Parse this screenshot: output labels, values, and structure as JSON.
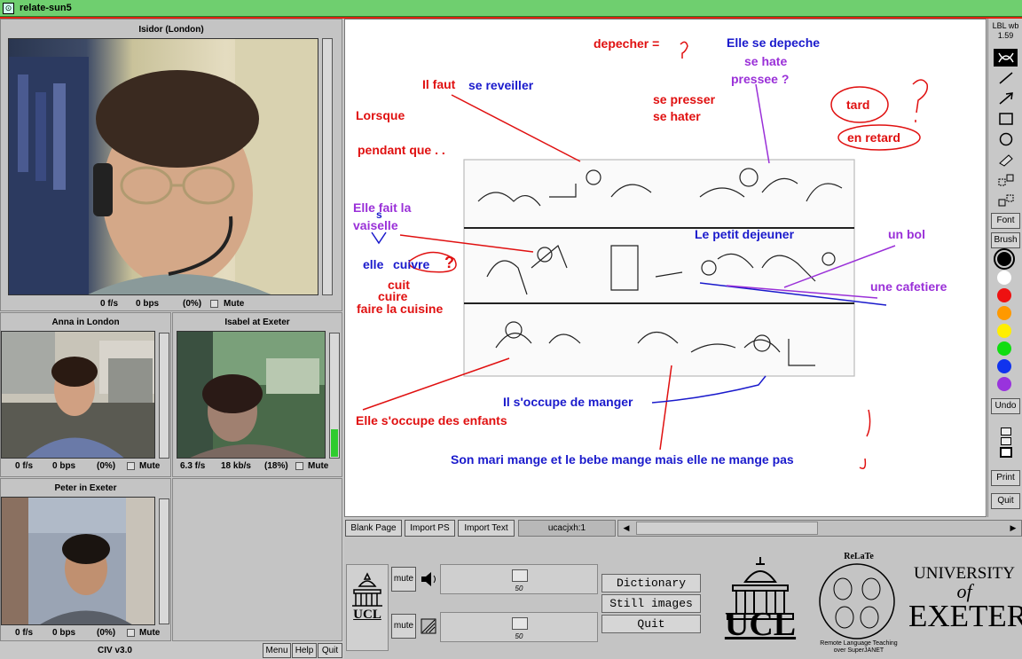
{
  "window": {
    "title": "relate-sun5",
    "menu_glyph": "⊙"
  },
  "videos": {
    "main": {
      "title": "Isidor (London)",
      "fps": "0 f/s",
      "bps": "0 bps",
      "pct": "(0%)",
      "mute": "Mute",
      "level": 0.0
    },
    "anna": {
      "title": "Anna in London",
      "fps": "0 f/s",
      "bps": "0 bps",
      "pct": "(0%)",
      "mute": "Mute",
      "level": 0.0
    },
    "isabel": {
      "title": "Isabel at Exeter",
      "fps": "6.3 f/s",
      "bps": "18 kb/s",
      "pct": "(18%)",
      "mute": "Mute",
      "level": 0.22
    },
    "peter": {
      "title": "Peter in Exeter",
      "fps": "0 f/s",
      "bps": "0 bps",
      "pct": "(0%)",
      "mute": "Mute",
      "level": 0.0
    }
  },
  "status_bar": {
    "version": "CIV v3.0",
    "menu": "Menu",
    "help": "Help",
    "quit": "Quit"
  },
  "whiteboard": {
    "annotations": {
      "depecher": "depecher = ",
      "elle_se_depeche": "Elle se depeche",
      "se_hate": "se hate",
      "pressee": "pressee ?",
      "il_faut": "Il faut",
      "se_reveiller": "se reveiller",
      "se_presser": "se presser",
      "se_hater": "se hater",
      "tard": "tard",
      "en_retard": "en retard",
      "lorsque": "Lorsque",
      "pendant_que": "pendant que . .",
      "elle_fait_la": "Elle fait la",
      "s_mark": "s",
      "vaiselle": "vaiselle",
      "elle": "elle",
      "cuivre": "cuivre",
      "qmark": "?",
      "cuit": "cuit",
      "cuire": "cuire",
      "faire_la_cuisine": "faire la cuisine",
      "le_petit_dejeuner": "Le petit dejeuner",
      "un_bol": "un bol",
      "une_cafetiere": "une cafetiere",
      "il_soccupe": "Il s'occupe de manger",
      "elle_soccupe": "Elle s'occupe des enfants",
      "son_mari": "Son mari mange et le bebe mange mais elle ne mange pas"
    }
  },
  "toolbar": {
    "app_label": "LBL wb",
    "version": "1.59",
    "font": "Font",
    "brush": "Brush",
    "undo": "Undo",
    "print": "Print",
    "quit": "Quit",
    "colors": [
      "#000000",
      "#ffffff",
      "#ee1111",
      "#ff9900",
      "#ffee00",
      "#11dd11",
      "#1133ee",
      "#9933dd"
    ]
  },
  "wb_bottom": {
    "blank_page": "Blank Page",
    "import_ps": "Import PS",
    "import_text": "Import Text",
    "page_id": "ucacjxh:1"
  },
  "audio": {
    "mute_top": "mute",
    "mute_bottom": "mute",
    "speaker_level": 50,
    "mic_level": 50
  },
  "buttons": {
    "dictionary": "Dictionary",
    "still_images": "Still images",
    "quit": "Quit"
  },
  "logos": {
    "ucl_small": "UCL",
    "ucl_big": "UCL",
    "relate_title": "ReLaTe",
    "relate_sub1": "Remote Language Teaching",
    "relate_sub2": "over SuperJANET",
    "exeter1": "UNIVERSITY",
    "exeter2": "of",
    "exeter3": "EXETER"
  }
}
